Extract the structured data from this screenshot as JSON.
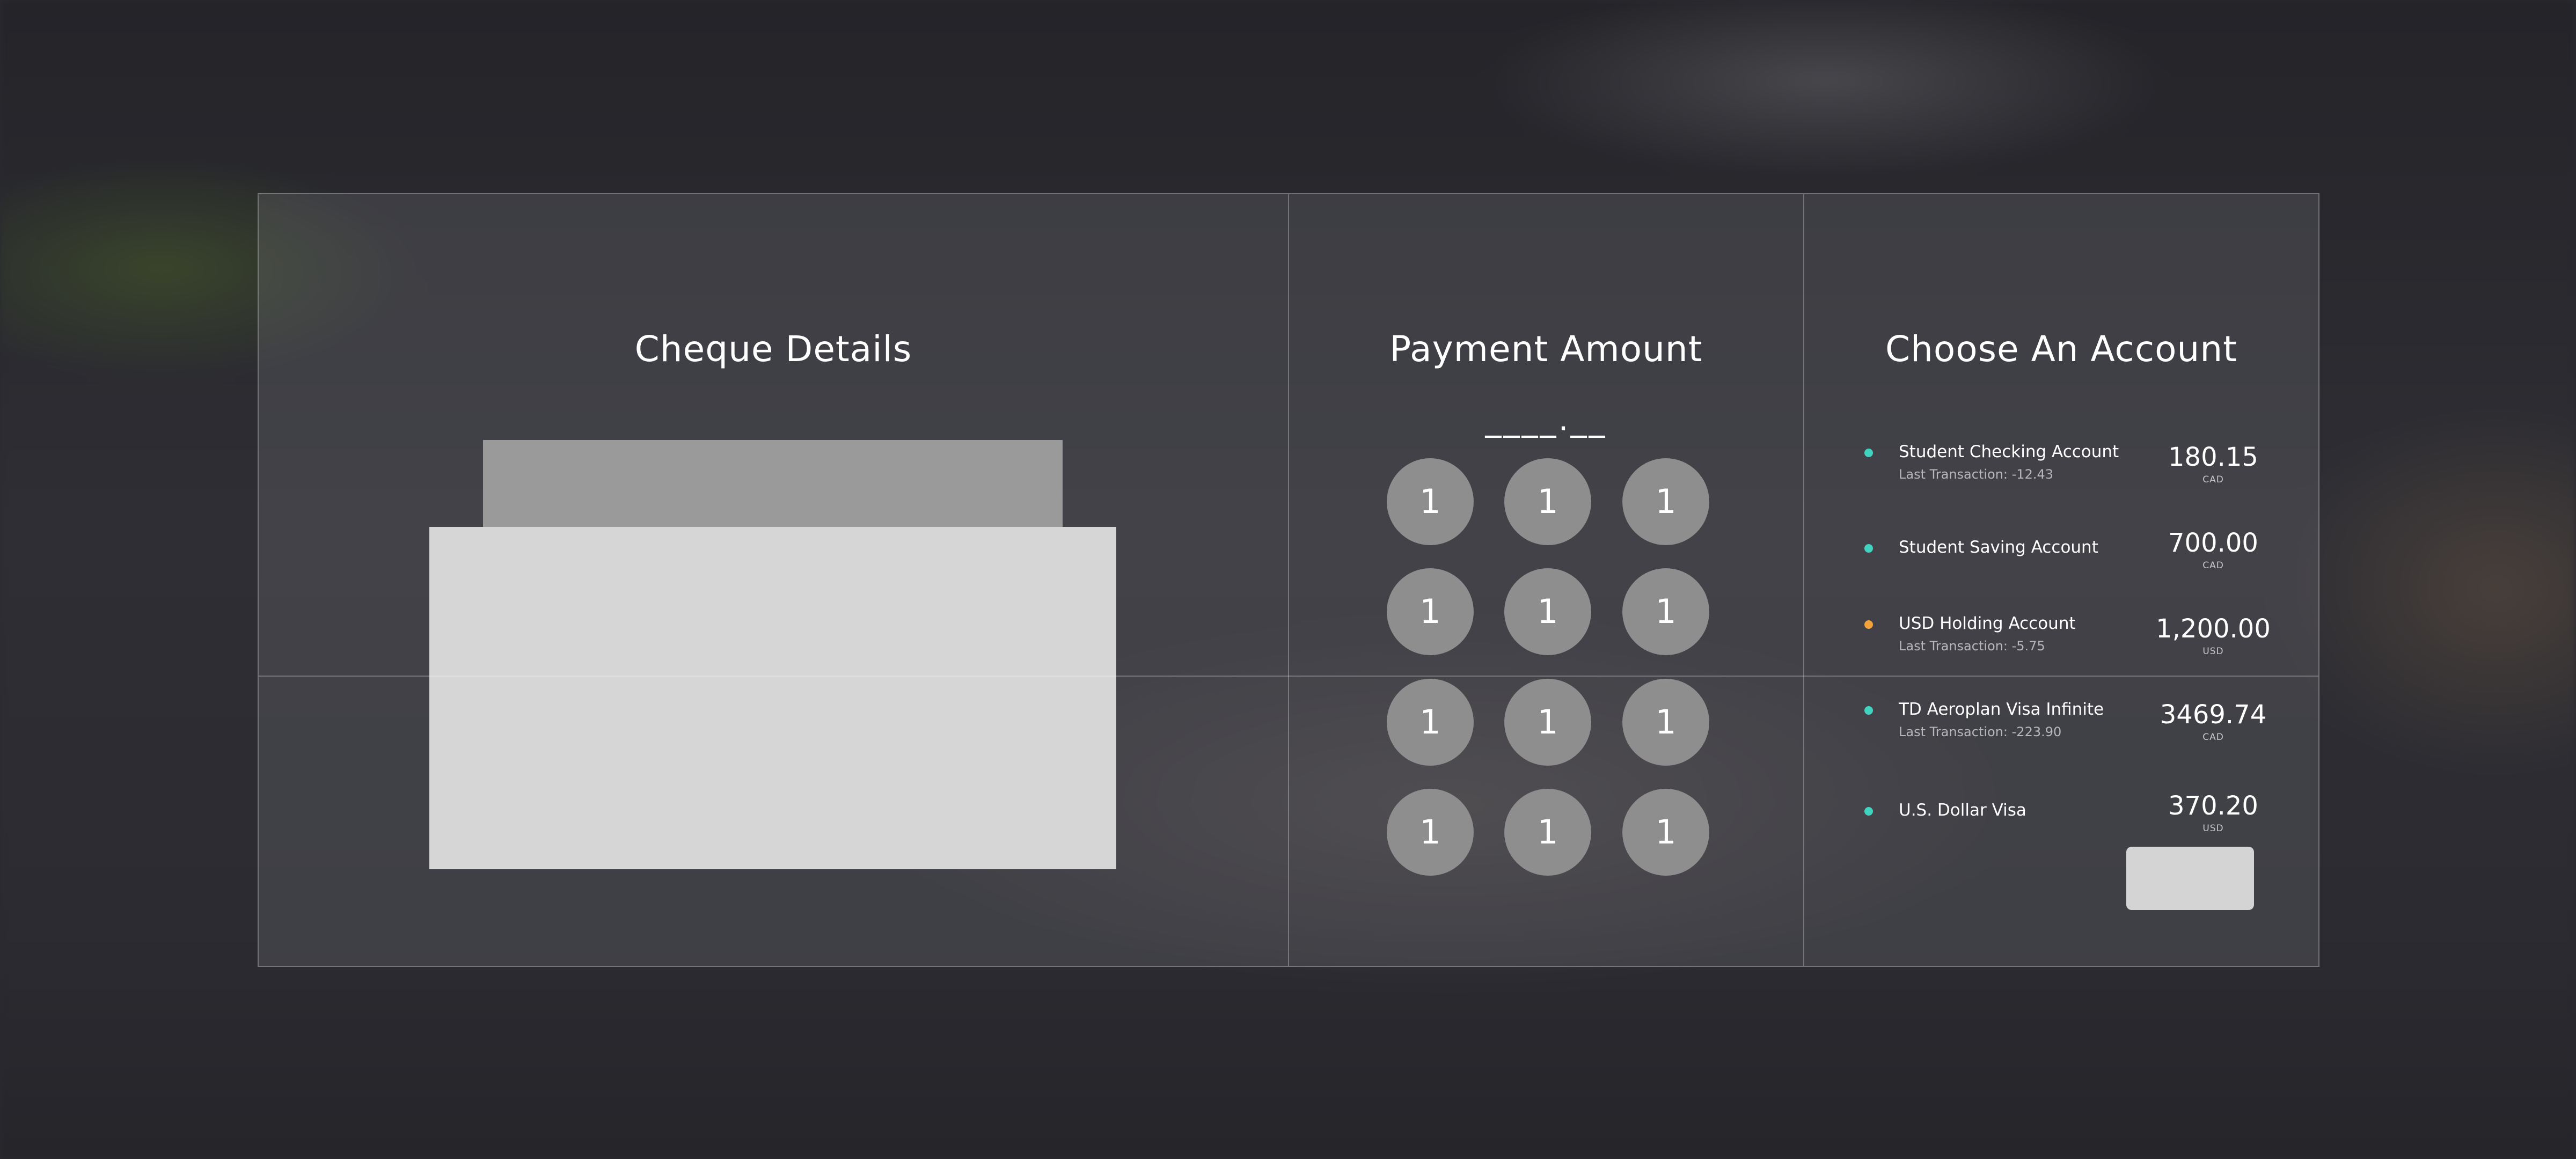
{
  "cheque_panel": {
    "title": "Cheque Details"
  },
  "payment_panel": {
    "title": "Payment Amount",
    "amount_display": "____.__",
    "keypad_keys": [
      "1",
      "1",
      "1",
      "1",
      "1",
      "1",
      "1",
      "1",
      "1",
      "1",
      "1",
      "1"
    ]
  },
  "account_panel": {
    "title": "Choose An Account",
    "accounts": [
      {
        "name": "Student Checking Account",
        "subtitle": "Last Transaction: -12.43",
        "amount": "180.15",
        "currency": "CAD",
        "status_color": "#3fd3c0"
      },
      {
        "name": "Student Saving Account",
        "subtitle": "",
        "amount": "700.00",
        "currency": "CAD",
        "status_color": "#3fd3c0"
      },
      {
        "name": "USD Holding Account",
        "subtitle": "Last Transaction: -5.75",
        "amount": "1,200.00",
        "currency": "USD",
        "status_color": "#f2a23a"
      },
      {
        "name": "TD Aeroplan Visa Infinite",
        "subtitle": "Last Transaction: -223.90",
        "amount": "3469.74",
        "currency": "CAD",
        "status_color": "#3fd3c0"
      },
      {
        "name": "U.S. Dollar Visa",
        "subtitle": "",
        "amount": "370.20",
        "currency": "USD",
        "status_color": "#3fd3c0"
      }
    ]
  }
}
